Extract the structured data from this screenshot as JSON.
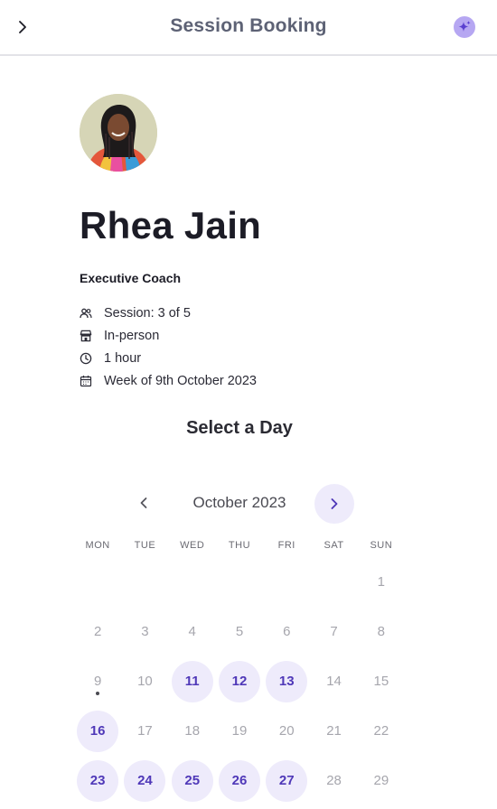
{
  "header": {
    "title": "Session Booking",
    "back_icon": "chevron-right-icon",
    "action_icon": "sparkle-icon"
  },
  "coach": {
    "name": "Rhea Jain",
    "role": "Executive Coach",
    "details": [
      {
        "icon": "people-icon",
        "text": "Session: 3 of 5"
      },
      {
        "icon": "store-icon",
        "text": "In-person"
      },
      {
        "icon": "clock-icon",
        "text": "1 hour"
      },
      {
        "icon": "calendar-icon",
        "text": "Week of 9th October 2023"
      }
    ]
  },
  "calendar": {
    "title": "Select a Day",
    "month_label": "October 2023",
    "weekdays": [
      "MON",
      "TUE",
      "WED",
      "THU",
      "FRI",
      "SAT",
      "SUN"
    ],
    "weeks": [
      [
        null,
        null,
        null,
        null,
        null,
        null,
        {
          "day": "1",
          "available": false
        }
      ],
      [
        {
          "day": "2",
          "available": false
        },
        {
          "day": "3",
          "available": false
        },
        {
          "day": "4",
          "available": false
        },
        {
          "day": "5",
          "available": false
        },
        {
          "day": "6",
          "available": false
        },
        {
          "day": "7",
          "available": false
        },
        {
          "day": "8",
          "available": false
        }
      ],
      [
        {
          "day": "9",
          "available": false,
          "today": true
        },
        {
          "day": "10",
          "available": false
        },
        {
          "day": "11",
          "available": true
        },
        {
          "day": "12",
          "available": true
        },
        {
          "day": "13",
          "available": true
        },
        {
          "day": "14",
          "available": false
        },
        {
          "day": "15",
          "available": false
        }
      ],
      [
        {
          "day": "16",
          "available": true
        },
        {
          "day": "17",
          "available": false
        },
        {
          "day": "18",
          "available": false
        },
        {
          "day": "19",
          "available": false
        },
        {
          "day": "20",
          "available": false
        },
        {
          "day": "21",
          "available": false
        },
        {
          "day": "22",
          "available": false
        }
      ],
      [
        {
          "day": "23",
          "available": true
        },
        {
          "day": "24",
          "available": true
        },
        {
          "day": "25",
          "available": true
        },
        {
          "day": "26",
          "available": true
        },
        {
          "day": "27",
          "available": true
        },
        {
          "day": "28",
          "available": false
        },
        {
          "day": "29",
          "available": false
        }
      ]
    ]
  },
  "colors": {
    "accent": "#4f38b8",
    "accent_light": "#eeebfb",
    "sparkle": "#b6a7f2"
  }
}
